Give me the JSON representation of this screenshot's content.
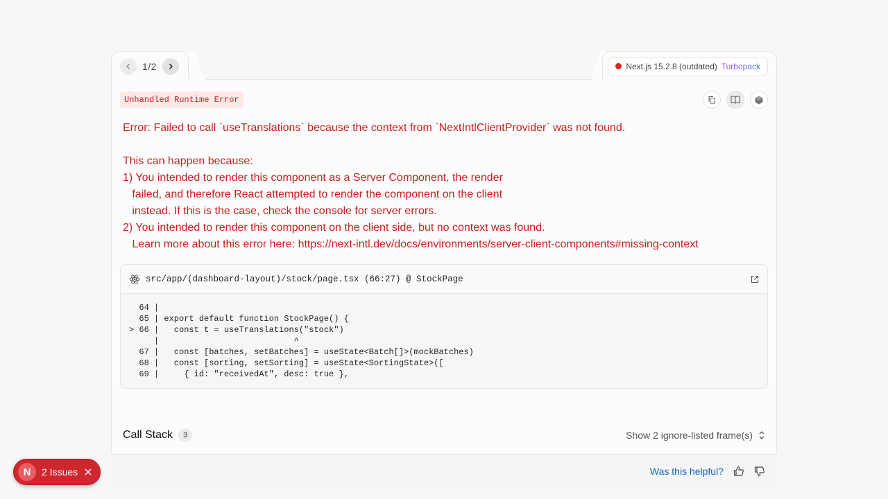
{
  "header": {
    "pager": "1/2",
    "prev_icon": "chevron-left-icon",
    "next_icon": "chevron-right-icon",
    "framework": "Next.js 15.2.8 (outdated)",
    "bundler": "Turbopack"
  },
  "error": {
    "badge": "Unhandled Runtime Error",
    "lines": [
      "Error: Failed to call `useTranslations` because the context from `NextIntlClientProvider` was not found.",
      "",
      "This can happen because:",
      "1) You intended to render this component as a Server Component, the render",
      "   failed, and therefore React attempted to render the component on the client",
      "   instead. If this is the case, check the console for server errors.",
      "2) You intended to render this component on the client side, but no context was found.",
      "   Learn more about this error here: https://next-intl.dev/docs/environments/server-client-components#missing-context"
    ]
  },
  "code_frame": {
    "file": "src/app/(dashboard-layout)/stock/page.tsx (66:27) @ StockPage",
    "lines": [
      "  64 |",
      "  65 | export default function StockPage() {",
      "> 66 |   const t = useTranslations(\"stock\")",
      "     |                           ^",
      "  67 |   const [batches, setBatches] = useState<Batch[]>(mockBatches)",
      "  68 |   const [sorting, setSorting] = useState<SortingState>([",
      "  69 |     { id: \"receivedAt\", desc: true },"
    ]
  },
  "call_stack": {
    "title": "Call Stack",
    "count": "3",
    "toggle": "Show 2 ignore-listed frame(s)"
  },
  "footer": {
    "helpful": "Was this helpful?"
  },
  "issues": {
    "logo": "N",
    "label": "2 Issues"
  },
  "colors": {
    "error_red": "#c81e1e",
    "pill_red": "#d0272e",
    "link_blue": "#1565c0"
  }
}
